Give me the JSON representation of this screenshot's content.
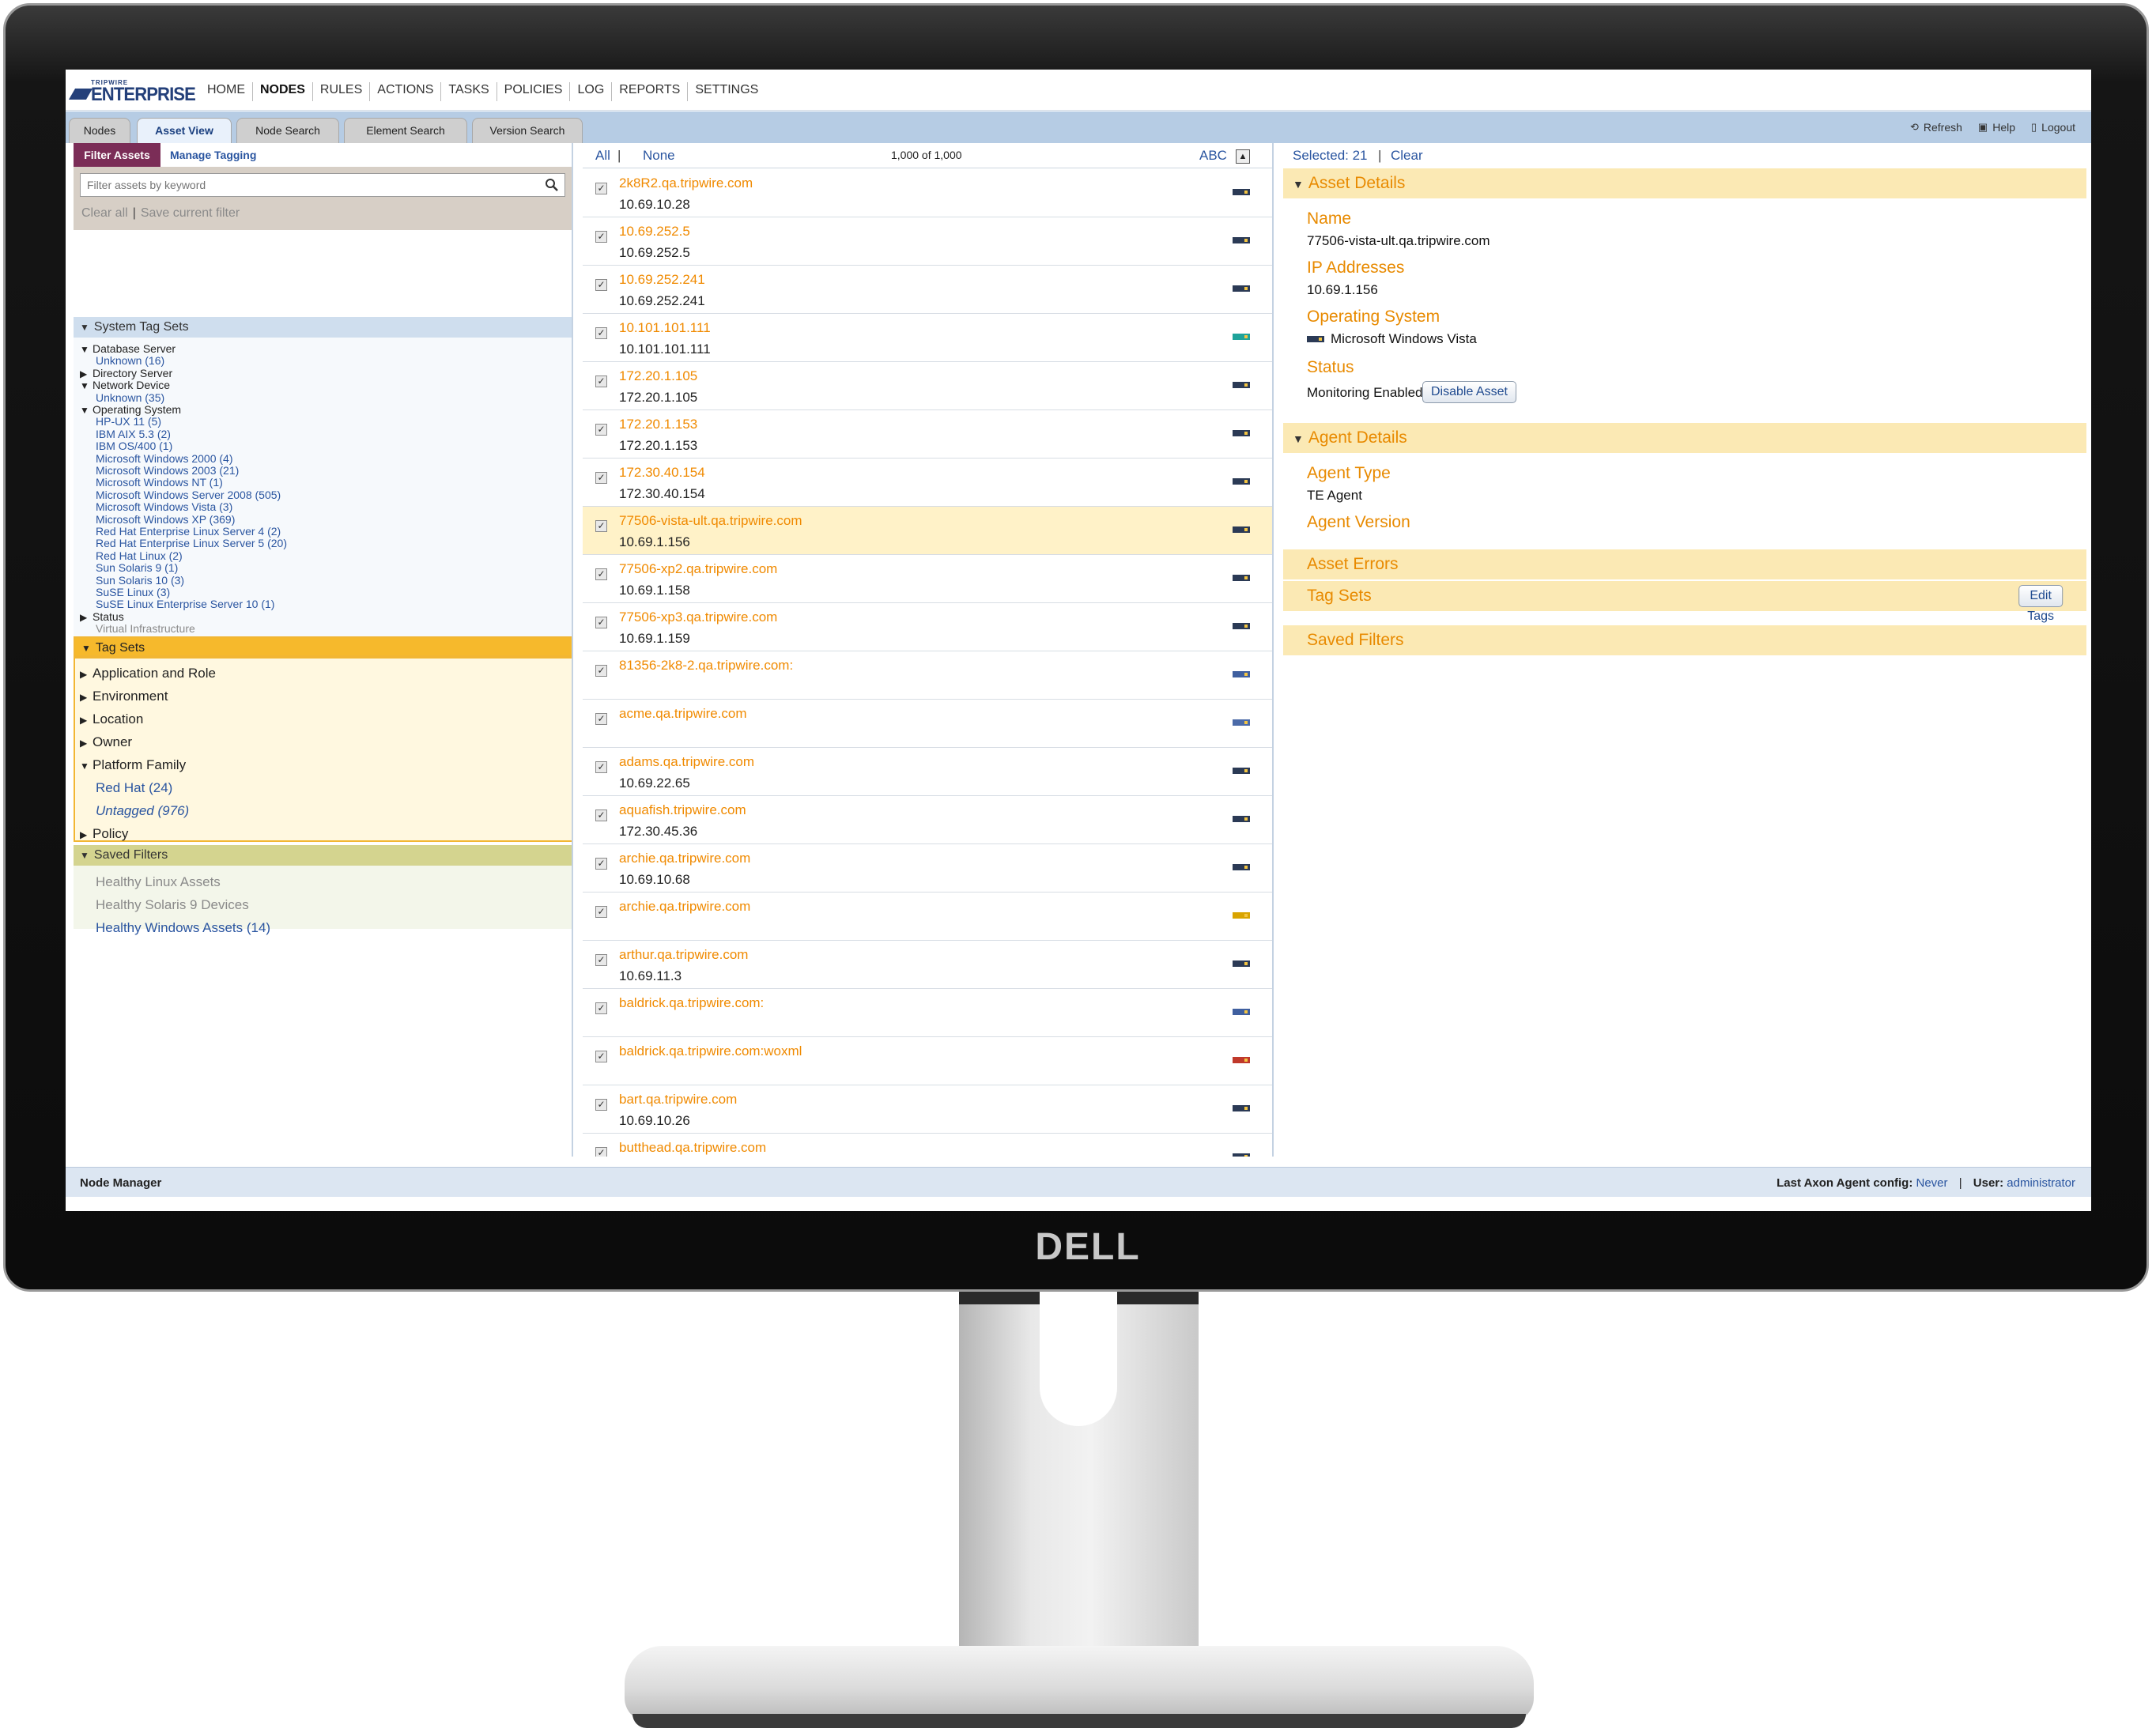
{
  "brand": "DELL",
  "app": {
    "logo_small": "TRIPWIRE",
    "logo_big": "ENTERPRISE",
    "nav": [
      "HOME",
      "NODES",
      "RULES",
      "ACTIONS",
      "TASKS",
      "POLICIES",
      "LOG",
      "REPORTS",
      "SETTINGS"
    ],
    "active_nav": "NODES"
  },
  "tabs": [
    "Nodes",
    "Asset View",
    "Node Search",
    "Element Search",
    "Version Search"
  ],
  "active_tab": "Asset View",
  "util": {
    "refresh": "Refresh",
    "help": "Help",
    "logout": "Logout"
  },
  "left": {
    "tab_filter": "Filter Assets",
    "tab_manage": "Manage Tagging",
    "search_placeholder": "Filter assets by keyword",
    "clear_all": "Clear all",
    "save_filter": "Save current filter",
    "system_tag_sets": "System Tag Sets",
    "system_rows": [
      {
        "label": "Database Server",
        "kind": "parent",
        "expanded": true
      },
      {
        "label": "Unknown (16)",
        "kind": "child"
      },
      {
        "label": "Directory Server",
        "kind": "parent",
        "expanded": false
      },
      {
        "label": "Network Device",
        "kind": "parent",
        "expanded": true
      },
      {
        "label": "Unknown (35)",
        "kind": "child"
      },
      {
        "label": "Operating System",
        "kind": "parent",
        "expanded": true
      },
      {
        "label": "HP-UX 11 (5)",
        "kind": "child"
      },
      {
        "label": "IBM AIX 5.3 (2)",
        "kind": "child"
      },
      {
        "label": "IBM OS/400 (1)",
        "kind": "child"
      },
      {
        "label": "Microsoft Windows 2000 (4)",
        "kind": "child"
      },
      {
        "label": "Microsoft Windows 2003 (21)",
        "kind": "child"
      },
      {
        "label": "Microsoft Windows NT (1)",
        "kind": "child"
      },
      {
        "label": "Microsoft Windows Server 2008 (505)",
        "kind": "child"
      },
      {
        "label": "Microsoft Windows Vista (3)",
        "kind": "child"
      },
      {
        "label": "Microsoft Windows XP (369)",
        "kind": "child"
      },
      {
        "label": "Red Hat Enterprise Linux Server 4 (2)",
        "kind": "child"
      },
      {
        "label": "Red Hat Enterprise Linux Server 5 (20)",
        "kind": "child"
      },
      {
        "label": "Red Hat Linux (2)",
        "kind": "child"
      },
      {
        "label": "Sun Solaris 9 (1)",
        "kind": "child"
      },
      {
        "label": "Sun Solaris 10 (3)",
        "kind": "child"
      },
      {
        "label": "SuSE Linux (3)",
        "kind": "child"
      },
      {
        "label": "SuSE Linux Enterprise Server 10 (1)",
        "kind": "child"
      },
      {
        "label": "Status",
        "kind": "parent",
        "expanded": false
      },
      {
        "label": "Virtual Infrastructure",
        "kind": "muted"
      }
    ],
    "tag_sets": "Tag Sets",
    "tag_rows": [
      {
        "label": "Application and Role",
        "kind": "parent",
        "expanded": false
      },
      {
        "label": "Environment",
        "kind": "parent",
        "expanded": false
      },
      {
        "label": "Location",
        "kind": "parent",
        "expanded": false
      },
      {
        "label": "Owner",
        "kind": "parent",
        "expanded": false
      },
      {
        "label": "Platform Family",
        "kind": "parent",
        "expanded": true
      },
      {
        "label": "Red Hat (24)",
        "kind": "child"
      },
      {
        "label": "Untagged (976)",
        "kind": "child-italic"
      },
      {
        "label": "Policy",
        "kind": "parent",
        "expanded": false
      }
    ],
    "saved_filters": "Saved Filters",
    "saved_rows": [
      {
        "label": "Healthy Linux Assets",
        "kind": "muted"
      },
      {
        "label": "Healthy Solaris 9 Devices",
        "kind": "muted"
      },
      {
        "label": "Healthy Windows Assets (14)",
        "kind": "child"
      }
    ]
  },
  "list": {
    "all": "All",
    "none": "None",
    "count": "1,000 of 1,000",
    "sort": "ABC",
    "rows": [
      {
        "name": "2k8R2.qa.tripwire.com",
        "ip": "10.69.10.28",
        "icon": "server-icon",
        "color": "#2b3a55"
      },
      {
        "name": "10.69.252.5",
        "ip": "10.69.252.5",
        "icon": "server-icon",
        "color": "#2b3a55"
      },
      {
        "name": "10.69.252.241",
        "ip": "10.69.252.241",
        "icon": "server-icon",
        "color": "#2b3a55"
      },
      {
        "name": "10.101.101.111",
        "ip": "10.101.101.111",
        "icon": "network-device-icon",
        "color": "#1fa39a"
      },
      {
        "name": "172.20.1.105",
        "ip": "172.20.1.105",
        "icon": "server-icon",
        "color": "#2b3a55"
      },
      {
        "name": "172.20.1.153",
        "ip": "172.20.1.153",
        "icon": "server-icon",
        "color": "#2b3a55"
      },
      {
        "name": "172.30.40.154",
        "ip": "172.30.40.154",
        "icon": "server-icon",
        "color": "#2b3a55"
      },
      {
        "name": "77506-vista-ult.qa.tripwire.com",
        "ip": "10.69.1.156",
        "icon": "server-icon",
        "color": "#2b3a55",
        "selected": true
      },
      {
        "name": "77506-xp2.qa.tripwire.com",
        "ip": "10.69.1.158",
        "icon": "server-icon",
        "color": "#2b3a55"
      },
      {
        "name": "77506-xp3.qa.tripwire.com",
        "ip": "10.69.1.159",
        "icon": "server-icon",
        "color": "#2b3a55"
      },
      {
        "name": "81356-2k8-2.qa.tripwire.com:",
        "ip": "",
        "icon": "database-icon",
        "color": "#3f5f9f"
      },
      {
        "name": "acme.qa.tripwire.com",
        "ip": "",
        "icon": "directory-icon",
        "color": "#4b6aa8"
      },
      {
        "name": "adams.qa.tripwire.com",
        "ip": "10.69.22.65",
        "icon": "server-icon",
        "color": "#2b3a55"
      },
      {
        "name": "aquafish.tripwire.com",
        "ip": "172.30.45.36",
        "icon": "server-icon",
        "color": "#2b3a55"
      },
      {
        "name": "archie.qa.tripwire.com",
        "ip": "10.69.10.68",
        "icon": "server-icon",
        "color": "#2b3a55"
      },
      {
        "name": "archie.qa.tripwire.com",
        "ip": "",
        "icon": "application-icon",
        "color": "#d9a400"
      },
      {
        "name": "arthur.qa.tripwire.com",
        "ip": "10.69.11.3",
        "icon": "server-icon",
        "color": "#2b3a55"
      },
      {
        "name": "baldrick.qa.tripwire.com:",
        "ip": "",
        "icon": "database-icon",
        "color": "#3f5f9f"
      },
      {
        "name": "baldrick.qa.tripwire.com:woxml",
        "ip": "",
        "icon": "file-icon",
        "color": "#c0392b"
      },
      {
        "name": "bart.qa.tripwire.com",
        "ip": "10.69.10.26",
        "icon": "server-icon",
        "color": "#2b3a55"
      },
      {
        "name": "butthead.qa.tripwire.com",
        "ip": "",
        "icon": "server-icon",
        "color": "#2b3a55"
      }
    ]
  },
  "details": {
    "selected": "Selected: 21",
    "clear": "Clear",
    "asset_details": "Asset Details",
    "name_label": "Name",
    "name_value": "77506-vista-ult.qa.tripwire.com",
    "ip_label": "IP Addresses",
    "ip_value": "10.69.1.156",
    "os_label": "Operating System",
    "os_value": "Microsoft Windows Vista",
    "status_label": "Status",
    "status_value": "Monitoring Enabled",
    "disable_button": "Disable Asset",
    "agent_details": "Agent Details",
    "agent_type_label": "Agent Type",
    "agent_type_value": "TE Agent",
    "agent_version_label": "Agent Version",
    "asset_errors": "Asset Errors",
    "tag_sets": "Tag Sets",
    "edit_tags_button": "Edit Tags",
    "saved_filters": "Saved Filters"
  },
  "status": {
    "manager": "Node Manager",
    "axon_label": "Last Axon Agent config:",
    "axon_value": "Never",
    "user_label": "User:",
    "user_value": "administrator"
  },
  "colors": {
    "accent": "#e88a00",
    "link": "#2a55a0",
    "selected_row": "#fff2c8",
    "filter_tab": "#7b2d57"
  }
}
